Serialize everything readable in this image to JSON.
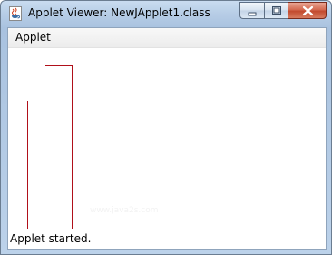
{
  "window": {
    "title": "Applet Viewer: NewJApplet1.class",
    "icon": "java-coffee-cup-icon"
  },
  "title_buttons": {
    "minimize": "minimize-icon",
    "maximize": "maximize-icon",
    "close": "close-icon"
  },
  "menubar": {
    "menus": [
      "Applet"
    ]
  },
  "canvas": {
    "line_color": "#b0101a",
    "watermark": "www.java2s.com"
  },
  "status": {
    "text": "Applet started."
  }
}
